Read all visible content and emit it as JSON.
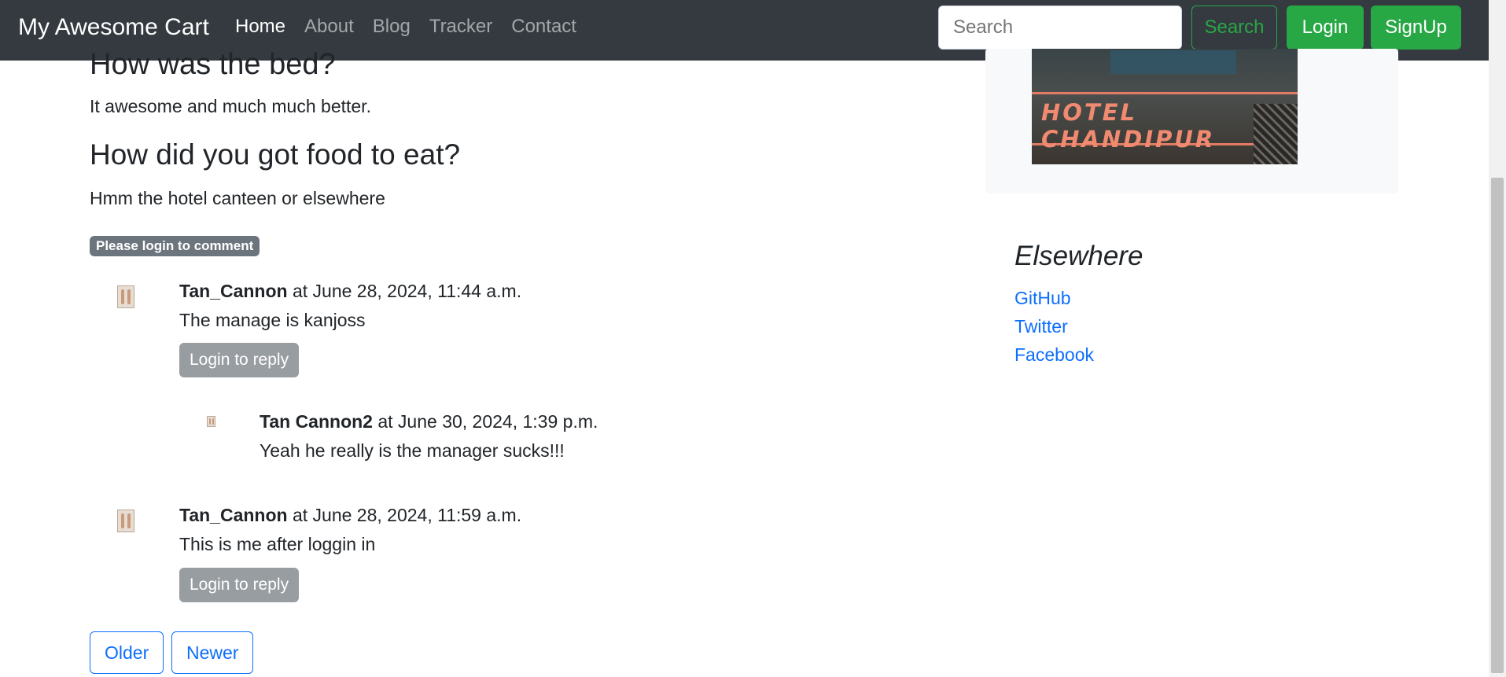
{
  "navbar": {
    "brand": "My Awesome Cart",
    "links": [
      "Home",
      "About",
      "Blog",
      "Tracker",
      "Contact"
    ],
    "search_placeholder": "Search",
    "search_button": "Search",
    "login_button": "Login",
    "signup_button": "SignUp"
  },
  "post": {
    "heading_cut": "How was the bed?",
    "answer1": "It awesome and much much better.",
    "heading2": "How did you got food to eat?",
    "answer2": "Hmm the hotel canteen or elsewhere"
  },
  "login_badge": "Please login to comment",
  "comments": [
    {
      "author": "Tan_Cannon",
      "meta": " at June 28, 2024, 11:44 a.m.",
      "text": "The manage is kanjoss",
      "reply_button": "Login to reply"
    },
    {
      "author": "Tan Cannon2",
      "meta": " at June 30, 2024, 1:39 p.m.",
      "text": "Yeah he really is the manager sucks!!!"
    },
    {
      "author": "Tan_Cannon",
      "meta": " at June 28, 2024, 11:59 a.m.",
      "text": "This is me after loggin in",
      "reply_button": "Login to reply"
    }
  ],
  "pagination": {
    "older": "Older",
    "newer": "Newer"
  },
  "sidebar": {
    "image_text": "HOTEL CHANDIPUR",
    "elsewhere_title": "Elsewhere",
    "links": [
      "GitHub",
      "Twitter",
      "Facebook"
    ]
  },
  "colors": {
    "navbar_bg": "#343a40",
    "success": "#28a745",
    "link": "#0d6efd",
    "secondary": "#6c757d"
  }
}
